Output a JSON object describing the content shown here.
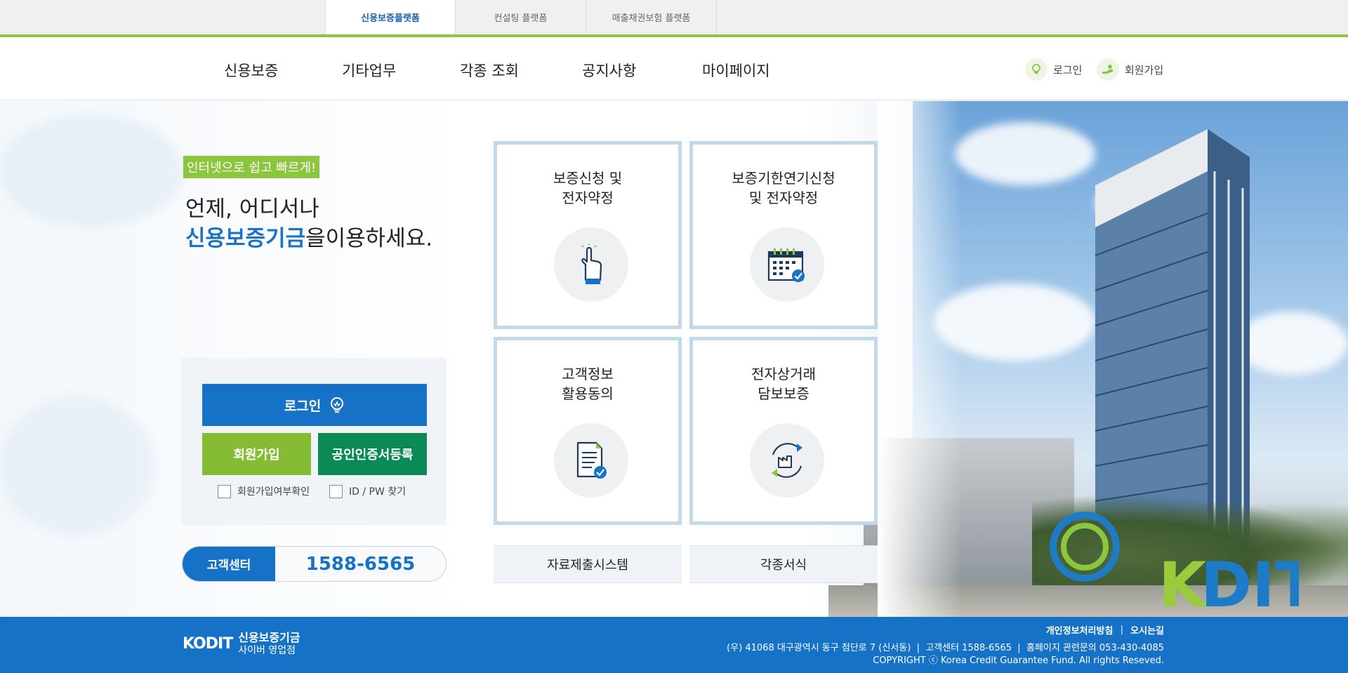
{
  "platform_tabs": [
    {
      "label": "신용보증플랫폼",
      "active": true
    },
    {
      "label": "컨설팅 플랫폼",
      "active": false
    },
    {
      "label": "매출채권보험 플랫폼",
      "active": false
    }
  ],
  "gnb": {
    "menu": [
      "신용보증",
      "기타업무",
      "각종 조회",
      "공지사항",
      "마이페이지"
    ],
    "login": "로그인",
    "signup": "회원가입"
  },
  "hero": {
    "badge": "인터넷으로 쉽고 빠르게!",
    "line1": "언제, 어디서나",
    "highlight": "신용보증기금",
    "line2_rest": "을이용하세요."
  },
  "login_box": {
    "login_button": "로그인",
    "join_button": "회원가입",
    "cert_button": "공인인증서등록",
    "check_member": "회원가입여부확인",
    "find_id_pw": "ID / PW 찾기"
  },
  "customer_center": {
    "label": "고객센터",
    "phone": "1588-6565"
  },
  "cards": [
    {
      "line1": "보증신청 및",
      "line2": "전자약정",
      "icon": "hand-pointer-icon"
    },
    {
      "line1": "보증기한연기신청",
      "line2": "및 전자약정",
      "icon": "calendar-check-icon"
    },
    {
      "line1": "고객정보",
      "line2": "활용동의",
      "icon": "document-check-icon"
    },
    {
      "line1": "전자상거래",
      "line2": "담보보증",
      "icon": "factory-cycle-icon"
    }
  ],
  "bottom_buttons": [
    "자료제출시스템",
    "각종서식"
  ],
  "footer": {
    "logo_mark": "KODIT",
    "logo_line1": "신용보증기금",
    "logo_line2": "사이버 영업점",
    "privacy": "개인정보처리방침",
    "directions": "오시는길",
    "address": "(우) 41068 대구광역시 동구 첨단로 7 (신서동)  |  고객센터 1588-6565  |  홈페이지 관련문의 053-430-4085",
    "copyright": "COPYRIGHT ⓒ Korea Credit Guarantee Fund. All rights Reseved."
  },
  "colors": {
    "brand_blue": "#1672c6",
    "brand_green": "#8bc63f",
    "cert_green": "#0a8a55",
    "card_border": "#c2d9ea"
  }
}
